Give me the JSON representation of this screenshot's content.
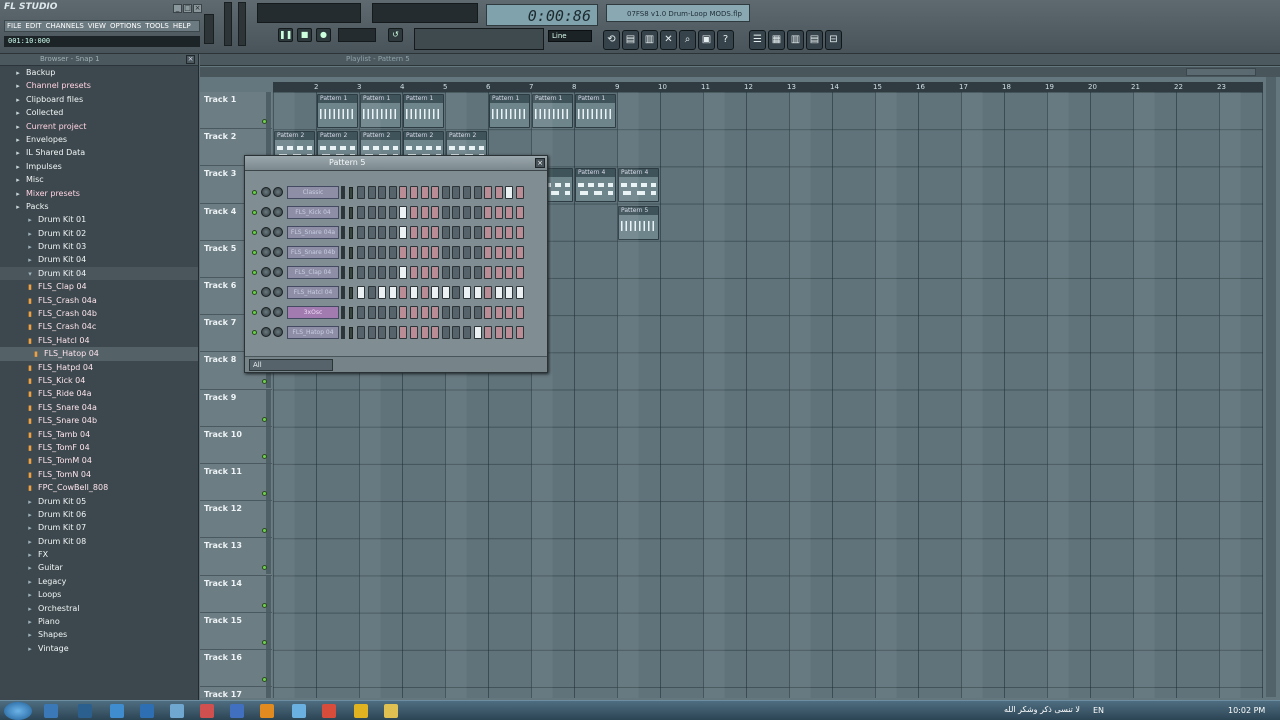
{
  "app": {
    "title": "FL STUDIO",
    "menu": [
      "FILE",
      "EDIT",
      "CHANNELS",
      "VIEW",
      "OPTIONS",
      "TOOLS",
      "HELP"
    ],
    "hint_time": "001:10:000"
  },
  "transport": {
    "time": "0:00:86",
    "snap": "Line",
    "song": "07FS8 v1.0 Drum-Loop MODS.flp"
  },
  "browser": {
    "title": "Browser - Snap 1",
    "items": [
      {
        "label": "Backup",
        "kind": "folder",
        "icon": "folder-icon"
      },
      {
        "label": "Channel presets",
        "kind": "folder-pink",
        "icon": "folder-icon"
      },
      {
        "label": "Clipboard files",
        "kind": "folder",
        "icon": "folder-icon"
      },
      {
        "label": "Collected",
        "kind": "folder",
        "icon": "folder-icon"
      },
      {
        "label": "Current project",
        "kind": "folder-pink",
        "icon": "folder-icon"
      },
      {
        "label": "Envelopes",
        "kind": "folder",
        "icon": "folder-icon"
      },
      {
        "label": "IL Shared Data",
        "kind": "folder",
        "icon": "folder-icon"
      },
      {
        "label": "Impulses",
        "kind": "folder",
        "icon": "folder-icon"
      },
      {
        "label": "Misc",
        "kind": "folder",
        "icon": "folder-icon"
      },
      {
        "label": "Mixer presets",
        "kind": "folder-pink",
        "icon": "folder-icon"
      },
      {
        "label": "Packs",
        "kind": "folder",
        "icon": "folder-icon"
      },
      {
        "label": "Drum Kit 01",
        "kind": "sub",
        "icon": "folder-icon"
      },
      {
        "label": "Drum Kit 02",
        "kind": "sub",
        "icon": "folder-icon"
      },
      {
        "label": "Drum Kit 03",
        "kind": "sub",
        "icon": "folder-icon"
      },
      {
        "label": "Drum Kit 04",
        "kind": "sub",
        "icon": "folder-icon"
      },
      {
        "label": "Drum Kit 04",
        "kind": "sub-open",
        "icon": "folder-open-icon"
      },
      {
        "label": "FLS_Clap 04",
        "kind": "file",
        "icon": "sample-icon"
      },
      {
        "label": "FLS_Crash 04a",
        "kind": "file",
        "icon": "sample-icon"
      },
      {
        "label": "FLS_Crash 04b",
        "kind": "file",
        "icon": "sample-icon"
      },
      {
        "label": "FLS_Crash 04c",
        "kind": "file",
        "icon": "sample-icon"
      },
      {
        "label": "FLS_Hatcl 04",
        "kind": "file",
        "icon": "sample-icon"
      },
      {
        "label": "FLS_Hatop 04",
        "kind": "file-sel",
        "icon": "sample-icon"
      },
      {
        "label": "FLS_Hatpd 04",
        "kind": "file",
        "icon": "sample-icon"
      },
      {
        "label": "FLS_Kick 04",
        "kind": "file",
        "icon": "sample-icon"
      },
      {
        "label": "FLS_Ride 04a",
        "kind": "file",
        "icon": "sample-icon"
      },
      {
        "label": "FLS_Snare 04a",
        "kind": "file",
        "icon": "sample-icon"
      },
      {
        "label": "FLS_Snare 04b",
        "kind": "file",
        "icon": "sample-icon"
      },
      {
        "label": "FLS_Tamb 04",
        "kind": "file",
        "icon": "sample-icon"
      },
      {
        "label": "FLS_TomF 04",
        "kind": "file",
        "icon": "sample-icon"
      },
      {
        "label": "FLS_TomM 04",
        "kind": "file",
        "icon": "sample-icon"
      },
      {
        "label": "FLS_TomN 04",
        "kind": "file",
        "icon": "sample-icon"
      },
      {
        "label": "FPC_CowBell_808",
        "kind": "file",
        "icon": "sample-icon"
      },
      {
        "label": "Drum Kit 05",
        "kind": "sub",
        "icon": "folder-icon"
      },
      {
        "label": "Drum Kit 06",
        "kind": "sub",
        "icon": "folder-icon"
      },
      {
        "label": "Drum Kit 07",
        "kind": "sub",
        "icon": "folder-icon"
      },
      {
        "label": "Drum Kit 08",
        "kind": "sub",
        "icon": "folder-icon"
      },
      {
        "label": "FX",
        "kind": "sub",
        "icon": "folder-icon"
      },
      {
        "label": "Guitar",
        "kind": "sub",
        "icon": "folder-icon"
      },
      {
        "label": "Legacy",
        "kind": "sub",
        "icon": "folder-icon"
      },
      {
        "label": "Loops",
        "kind": "sub",
        "icon": "folder-icon"
      },
      {
        "label": "Orchestral",
        "kind": "sub",
        "icon": "folder-icon"
      },
      {
        "label": "Piano",
        "kind": "sub",
        "icon": "folder-icon"
      },
      {
        "label": "Shapes",
        "kind": "sub",
        "icon": "folder-icon"
      },
      {
        "label": "Vintage",
        "kind": "sub",
        "icon": "folder-icon"
      }
    ]
  },
  "playlist": {
    "title": "Playlist - Pattern 5",
    "bars": [
      "2",
      "3",
      "4",
      "5",
      "6",
      "7",
      "8",
      "9",
      "10",
      "11",
      "12",
      "13",
      "14",
      "15",
      "16",
      "17",
      "18",
      "19",
      "20",
      "21",
      "22",
      "23"
    ],
    "tracks": [
      "Track 1",
      "Track 2",
      "Track 3",
      "Track 4",
      "Track 5",
      "Track 6",
      "Track 7",
      "Track 8",
      "Track 9",
      "Track 10",
      "Track 11",
      "Track 12",
      "Track 13",
      "Track 14",
      "Track 15",
      "Track 16",
      "Track 17"
    ],
    "clips": [
      {
        "label": "Pattern 1",
        "track": 0,
        "bar": 1,
        "bars": 1,
        "style": "dense"
      },
      {
        "label": "Pattern 1",
        "track": 0,
        "bar": 2,
        "bars": 1,
        "style": "dense"
      },
      {
        "label": "Pattern 1",
        "track": 0,
        "bar": 3,
        "bars": 1,
        "style": "dense"
      },
      {
        "label": "Pattern 1",
        "track": 0,
        "bar": 5,
        "bars": 1,
        "style": "dense"
      },
      {
        "label": "Pattern 1",
        "track": 0,
        "bar": 6,
        "bars": 1,
        "style": "dense"
      },
      {
        "label": "Pattern 1",
        "track": 0,
        "bar": 7,
        "bars": 1,
        "style": "dense"
      },
      {
        "label": "Pattern 2",
        "track": 1,
        "bar": 0,
        "bars": 1,
        "style": "wide"
      },
      {
        "label": "Pattern 2",
        "track": 1,
        "bar": 1,
        "bars": 1,
        "style": "wide"
      },
      {
        "label": "Pattern 2",
        "track": 1,
        "bar": 2,
        "bars": 1,
        "style": "wide"
      },
      {
        "label": "Pattern 2",
        "track": 1,
        "bar": 3,
        "bars": 1,
        "style": "wide"
      },
      {
        "label": "Pattern 2",
        "track": 1,
        "bar": 4,
        "bars": 1,
        "style": "wide"
      },
      {
        "label": "rn 4",
        "track": 2,
        "bar": 6,
        "bars": 1,
        "style": "wide"
      },
      {
        "label": "Pattern 4",
        "track": 2,
        "bar": 7,
        "bars": 1,
        "style": "wide"
      },
      {
        "label": "Pattern 4",
        "track": 2,
        "bar": 8,
        "bars": 1,
        "style": "wide"
      },
      {
        "label": "Pattern 5",
        "track": 3,
        "bar": 8,
        "bars": 1,
        "style": "dense"
      }
    ]
  },
  "stepseq": {
    "title": "Pattern 5",
    "filter": "All",
    "channels": [
      {
        "name": "Classic",
        "highlight": false,
        "steps": "0000000000000010"
      },
      {
        "name": "FLS_Kick 04",
        "highlight": false,
        "steps": "0000100000000000"
      },
      {
        "name": "FLS_Snare 04a",
        "highlight": false,
        "steps": "0000100000000000"
      },
      {
        "name": "FLS_Snare 04b",
        "highlight": false,
        "steps": "0000000000000000"
      },
      {
        "name": "FLS_Clap 04",
        "highlight": false,
        "steps": "0000100000000000"
      },
      {
        "name": "FLS_Hatcl 04",
        "highlight": false,
        "steps": "1011010110110111"
      },
      {
        "name": "3xOsc",
        "highlight": true,
        "steps": "0000000000000000"
      },
      {
        "name": "FLS_Hatop 04",
        "highlight": false,
        "steps": "0000000000010000"
      }
    ]
  },
  "taskbar": {
    "tray_text": "لا تنسى ذكر وشكر الله",
    "lang": "EN",
    "clock": "10:02 PM"
  },
  "colors": {
    "background": "#5d6d74",
    "grid": "#60737a",
    "step_pink": "#b98c96",
    "step_on": "#ecf2f3",
    "accent_orange": "#f0a040"
  }
}
